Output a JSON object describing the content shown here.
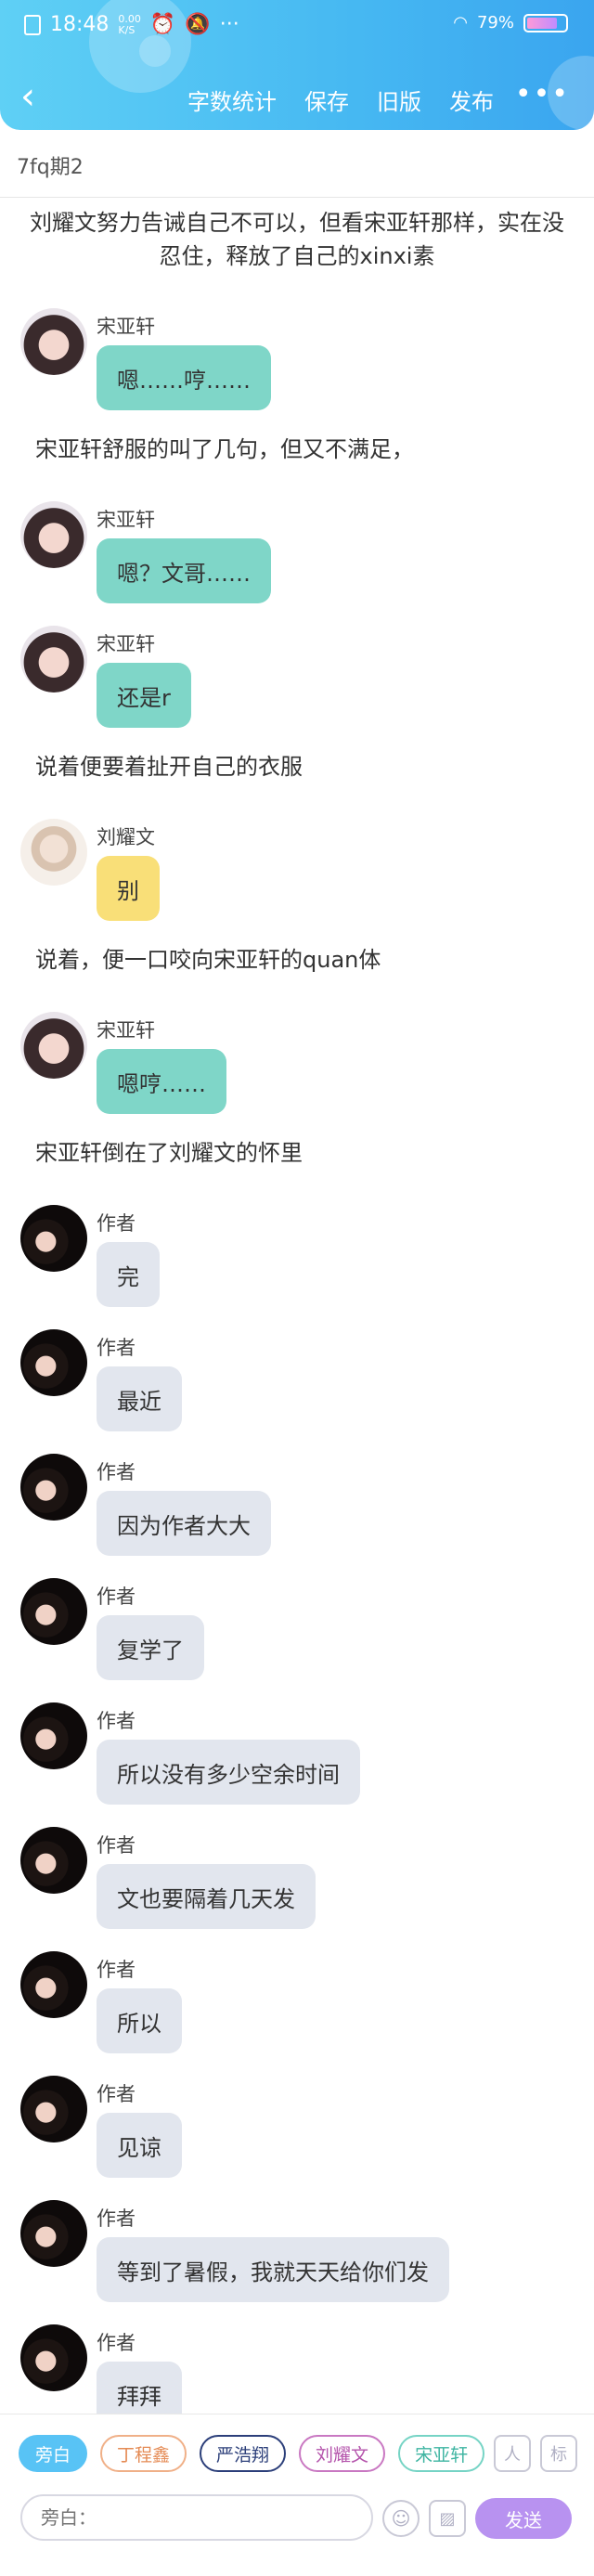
{
  "status_bar": {
    "time": "18:48",
    "small_top": "0.00",
    "small_bottom": "K/S",
    "more": "···",
    "battery_percent": "79%",
    "battery_level": 0.79
  },
  "toolbar": {
    "items": [
      "字数统计",
      "保存",
      "旧版",
      "发布"
    ],
    "more": "•••",
    "back": "‹"
  },
  "subtitle": "7fq期2",
  "narration": [
    "刘耀文努力告诫自己不可以，但看宋亚轩那样，实在没忍住，释放了自己的xinxi素",
    "宋亚轩舒服的叫了几句，但又不满足，",
    "说着便要着扯开自己的衣服",
    "说着，便一口咬向宋亚轩的quan体",
    "宋亚轩倒在了刘耀文的怀里"
  ],
  "messages": [
    {
      "name": "宋亚轩",
      "text": "嗯……哼……"
    },
    {
      "name": "宋亚轩",
      "text": "嗯？文哥……"
    },
    {
      "name": "宋亚轩",
      "text": "还是r"
    },
    {
      "name": "刘耀文",
      "text": "别"
    },
    {
      "name": "宋亚轩",
      "text": "嗯哼……"
    },
    {
      "name": "作者",
      "text": "完"
    },
    {
      "name": "作者",
      "text": "最近"
    },
    {
      "name": "作者",
      "text": "因为作者大大"
    },
    {
      "name": "作者",
      "text": "复学了"
    },
    {
      "name": "作者",
      "text": "所以没有多少空余时间"
    },
    {
      "name": "作者",
      "text": "文也要隔着几天发"
    },
    {
      "name": "作者",
      "text": "所以"
    },
    {
      "name": "作者",
      "text": "见谅"
    },
    {
      "name": "作者",
      "text": "等到了暑假，我就天天给你们发"
    },
    {
      "name": "作者",
      "text": "拜拜"
    }
  ],
  "bottom": {
    "chips": [
      "旁白",
      "丁程鑫",
      "严浩翔",
      "刘耀文",
      "宋亚轩"
    ],
    "role_button": "人",
    "tag_button": "标",
    "input_placeholder": "旁白：",
    "emoji_button": "☺",
    "image_button": "▨",
    "send_label": "发送"
  },
  "colors": {
    "header_start": "#5fd0f5",
    "header_end": "#3aa5ef",
    "bubble_teal": "#7fd6c8",
    "bubble_yellow": "#f9df78",
    "bubble_grey": "#e2e6ee",
    "send": "#b892f0"
  }
}
